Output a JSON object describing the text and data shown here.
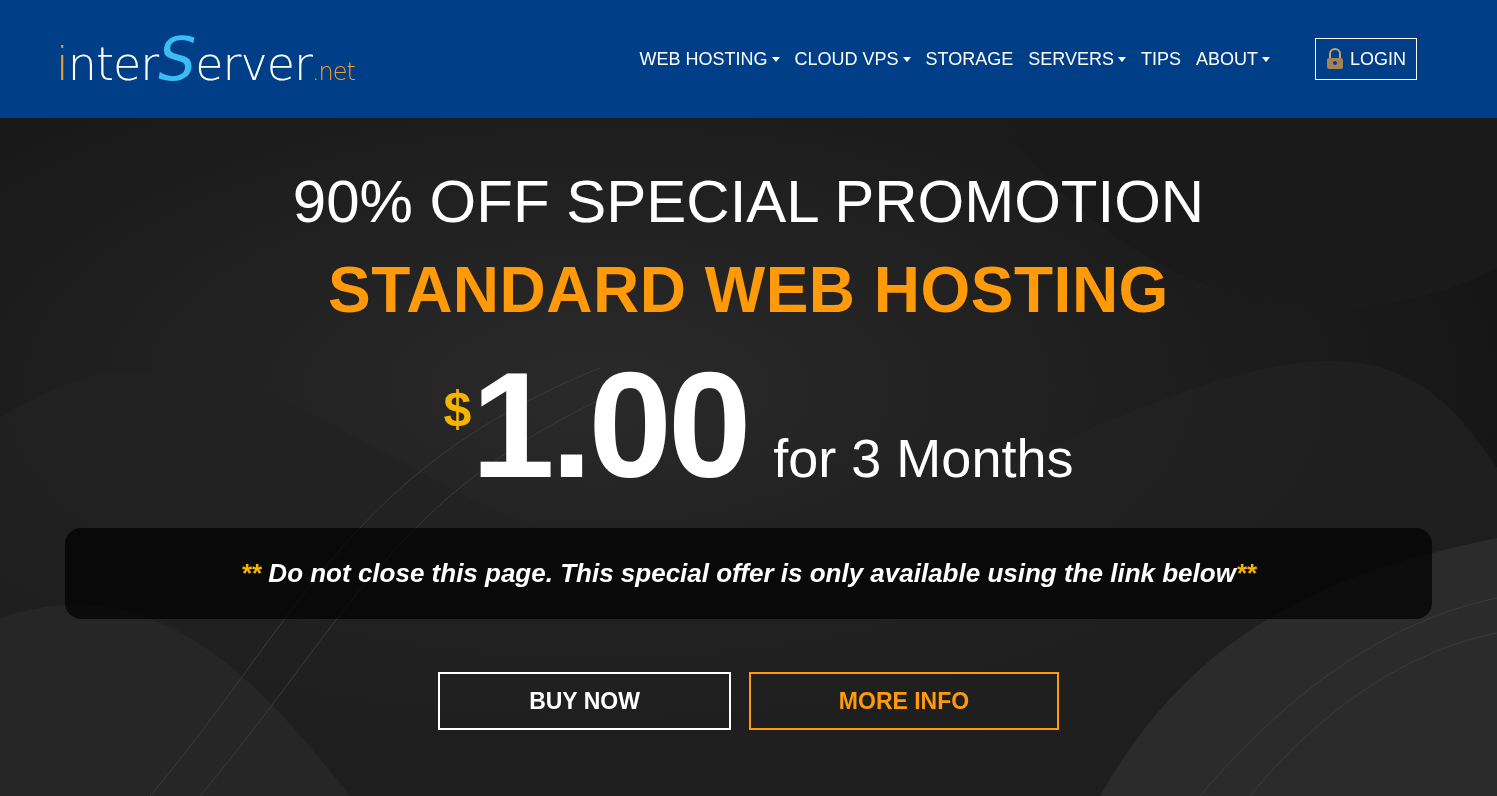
{
  "logo": {
    "parts": [
      {
        "text": "i",
        "color": "#f0a030"
      },
      {
        "text": "nter",
        "color": "#ffffff"
      },
      {
        "text": "S",
        "color": "#3cbcf5"
      },
      {
        "text": "erver",
        "color": "#ffffff"
      },
      {
        "text": ".net",
        "color": "#f0a030"
      }
    ]
  },
  "nav": [
    {
      "label": "WEB HOSTING",
      "dropdown": true
    },
    {
      "label": "CLOUD VPS",
      "dropdown": true
    },
    {
      "label": "STORAGE",
      "dropdown": false
    },
    {
      "label": "SERVERS",
      "dropdown": true
    },
    {
      "label": "TIPS",
      "dropdown": false
    },
    {
      "label": "ABOUT",
      "dropdown": true
    }
  ],
  "login": {
    "label": "LOGIN"
  },
  "hero": {
    "title": "90% OFF SPECIAL PROMOTION",
    "subtitle": "STANDARD WEB HOSTING",
    "price": {
      "currency": "$",
      "amount": "1.00",
      "term": "for 3 Months"
    },
    "notice": {
      "lead": "**",
      "text": " Do not close this page. This special offer is only available using the link below",
      "trail": "**"
    },
    "buttons": [
      {
        "label": "BUY NOW",
        "kind": "primary"
      },
      {
        "label": "MORE INFO",
        "kind": "secondary"
      }
    ]
  }
}
